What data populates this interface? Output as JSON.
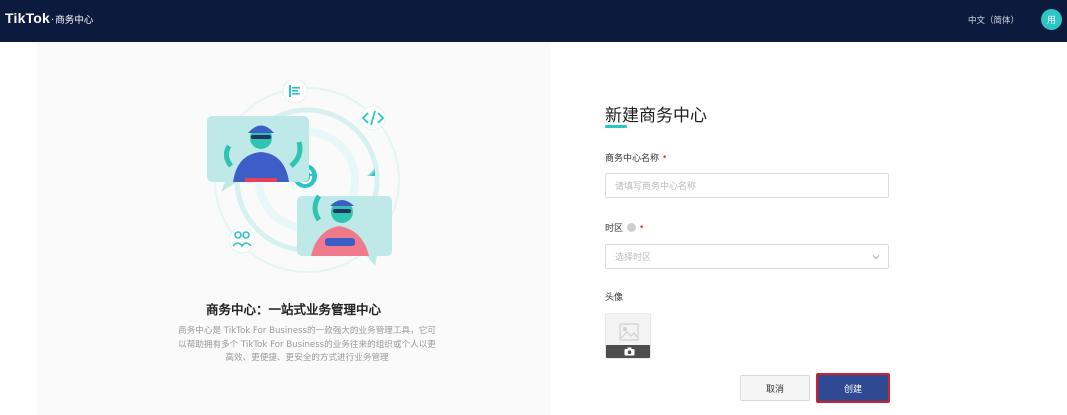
{
  "header": {
    "brand_logo": "TikTok",
    "brand_dot": "·",
    "brand_product": "商务中心",
    "language": "中文（简体）",
    "avatar_initial": "用"
  },
  "intro": {
    "title": "商务中心：一站式业务管理中心",
    "description": "商务中心是 TikTok For Business的一款强大的业务管理工具，它可以帮助拥有多个 TikTok For Business的业务往来的组织或个人以更高效、更便捷、更安全的方式进行业务管理"
  },
  "form": {
    "title": "新建商务中心",
    "name_label": "商务中心名称",
    "name_placeholder": "请填写商务中心名称",
    "timezone_label": "时区",
    "timezone_placeholder": "选择时区",
    "avatar_label": "头像",
    "required_mark": "•"
  },
  "buttons": {
    "cancel": "取消",
    "create": "创建"
  },
  "colors": {
    "header_bg": "#0c1a3d",
    "accent": "#2cc4c4",
    "primary_button": "#2f4a93",
    "highlight_border": "#d21f2a"
  }
}
